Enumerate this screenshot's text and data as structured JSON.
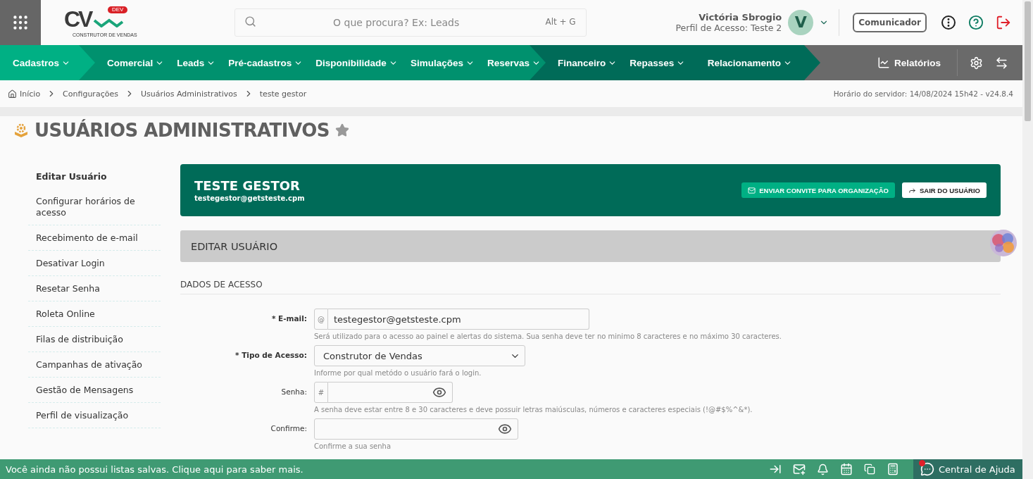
{
  "logo": {
    "letters": "CV",
    "badge": "DEV",
    "subtitle": "CONSTRUTOR DE VENDAS"
  },
  "header": {
    "search": {
      "placeholder": "O que procura? Ex: Leads",
      "shortcut": "Alt + G"
    },
    "user": {
      "name": "Victória Sbrogio",
      "profile": "Perfil de Acesso: Teste 2",
      "initial": "V"
    },
    "communicator_button": "Comunicador"
  },
  "nav": {
    "sections": [
      {
        "items": [
          "Cadastros"
        ]
      },
      {
        "items": [
          "Comercial",
          "Leads",
          "Pré-cadastros",
          "Disponibilidade",
          "Simulações",
          "Reservas"
        ]
      },
      {
        "items": [
          "Financeiro",
          "Repasses",
          "Relacionamento"
        ]
      }
    ],
    "reports": "Relatórios"
  },
  "breadcrumb": {
    "items": [
      "Início",
      "Configurações",
      "Usuários Administrativos",
      "teste gestor"
    ],
    "server_time": "Horário do servidor: 14/08/2024 15h42 - v24.8.4"
  },
  "page_title": "USUÁRIOS ADMINISTRATIVOS",
  "favorite": false,
  "sidebar": {
    "items": [
      {
        "label": "Editar Usuário",
        "selected": true
      },
      {
        "label": "Configurar horários de acesso",
        "selected": false
      },
      {
        "label": "Recebimento de e-mail",
        "selected": false
      },
      {
        "label": "Desativar Login",
        "selected": false
      },
      {
        "label": "Resetar Senha",
        "selected": false
      },
      {
        "label": "Roleta Online",
        "selected": false
      },
      {
        "label": "Filas de distribuição",
        "selected": false
      },
      {
        "label": "Campanhas de ativação",
        "selected": false
      },
      {
        "label": "Gestão de Mensagens",
        "selected": false
      },
      {
        "label": "Perfil de visualização",
        "selected": false
      }
    ]
  },
  "user_card": {
    "name": "TESTE GESTOR",
    "email": "testegestor@getsteste.cpm",
    "buttons": [
      {
        "kind": "invite",
        "label": "ENVIAR CONVITE PARA ORGANIZAÇÃO"
      },
      {
        "kind": "logout",
        "label": "SAIR DO USUÁRIO"
      }
    ]
  },
  "section_header": "EDITAR USUÁRIO",
  "subsection": "DADOS DE ACESSO",
  "fields": [
    {
      "kind": "text",
      "label": "* E-mail:",
      "required": true,
      "prefix": "@",
      "value": "testegestor@getsteste.cpm",
      "help": "Será utilizado para o acesso ao painel e alertas do sistema. Sua senha deve ter no minimo 8 caracteres e no máximo 30 caracteres."
    },
    {
      "kind": "select",
      "label": "* Tipo de Acesso:",
      "required": true,
      "value": "Construtor de Vendas",
      "help": "Informe por qual metódo o usuário fará o login."
    },
    {
      "kind": "password",
      "label": "Senha:",
      "required": false,
      "prefix": "#",
      "help": "A senha deve estar entre 8 e 30 caracteres e deve possuir letras maiúsculas, números e caracteres especiais (!@#$%^&*)."
    },
    {
      "kind": "password",
      "label": "Confirme:",
      "required": false,
      "help": "Confirme a sua senha"
    }
  ],
  "footer": {
    "message": "Você ainda não possui listas salvas. Clique aqui para saber mais.",
    "help": "Central de Ajuda",
    "help_notification": true
  }
}
